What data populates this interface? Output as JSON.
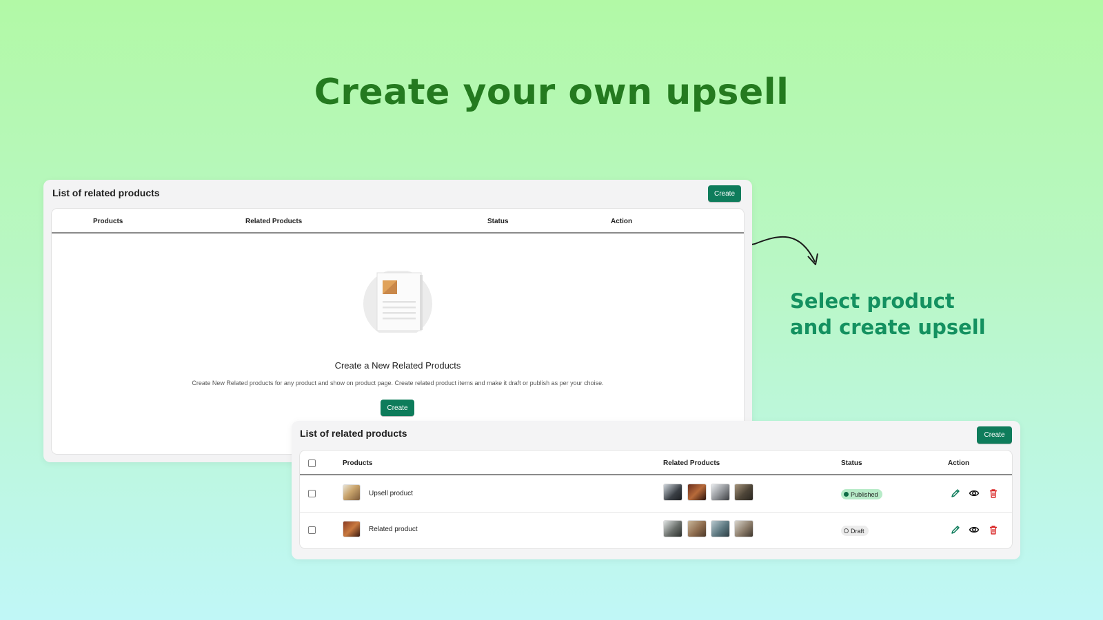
{
  "headline": "Create your own upsell",
  "callout": {
    "line1": "Select product",
    "line2": "and create upsell"
  },
  "colors": {
    "accent": "#0e7c5b",
    "headline": "#247a1f",
    "callout": "#149160",
    "delete": "#d92626"
  },
  "panel_empty": {
    "title": "List of related products",
    "create_label": "Create",
    "columns": [
      "Products",
      "Related Products",
      "Status",
      "Action"
    ],
    "empty_state": {
      "icon": "document-icon",
      "heading": "Create a New Related Products",
      "description": "Create New Related products for any product and show on product page. Create related product items and make it draft or publish as per your choise.",
      "button_label": "Create"
    }
  },
  "panel_list": {
    "title": "List of related products",
    "create_label": "Create",
    "columns": [
      "Products",
      "Related Products",
      "Status",
      "Action"
    ],
    "rows": [
      {
        "product": "Upsell product",
        "status": "Published",
        "related_count": 4
      },
      {
        "product": "Related product",
        "status": "Draft",
        "related_count": 4
      }
    ],
    "actions": [
      "edit-icon",
      "view-icon",
      "delete-icon"
    ]
  }
}
